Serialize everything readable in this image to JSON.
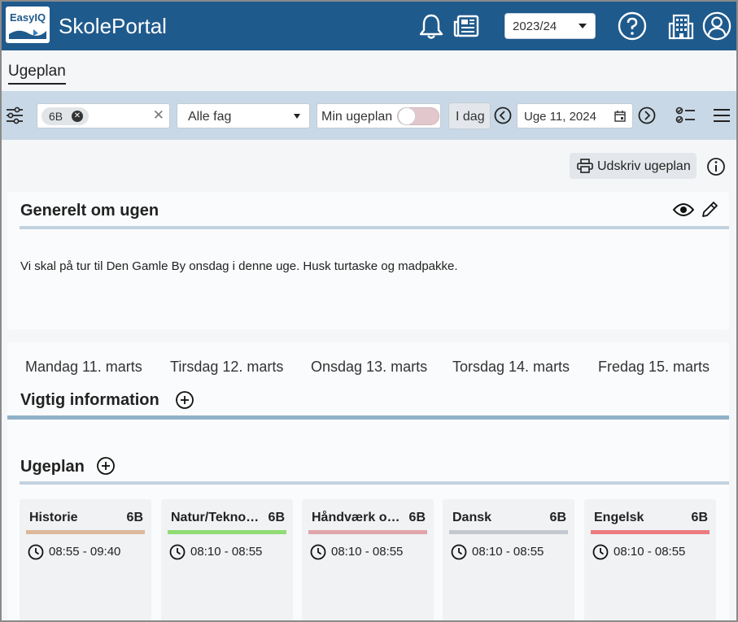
{
  "header": {
    "logo_text": "EasyIQ",
    "app_title": "SkolePortal",
    "year_select": "2023/24",
    "icons": [
      "bell-icon",
      "newspaper-icon",
      "help-icon",
      "building-icon",
      "user-icon"
    ]
  },
  "page": {
    "tab": "Ugeplan"
  },
  "toolbar": {
    "class_chip": "6B",
    "subject_select": "Alle fag",
    "my_plan_label": "Min ugeplan",
    "my_plan_on": false,
    "today_label": "I dag",
    "week_value": "Uge 11, 2024"
  },
  "actions": {
    "print_label": "Udskriv ugeplan"
  },
  "general": {
    "title": "Generelt om ugen",
    "text": "Vi skal på tur til Den Gamle By onsdag i denne uge. Husk turtaske og madpakke."
  },
  "days": [
    "Mandag 11. marts",
    "Tirsdag 12. marts",
    "Onsdag 13. marts",
    "Torsdag 14. marts",
    "Fredag 15. marts"
  ],
  "important": {
    "title": "Vigtig information"
  },
  "weekplan": {
    "title": "Ugeplan"
  },
  "lessons": [
    {
      "subject": "Historie",
      "class": "6B",
      "time": "08:55 - 09:40",
      "color": "#dcb89a"
    },
    {
      "subject": "Natur/Teknologi",
      "class": "6B",
      "time": "08:10 - 08:55",
      "color": "#8fdc72"
    },
    {
      "subject": "Håndværk og design",
      "class": "6B",
      "time": "08:10 - 08:55",
      "color": "#e0a5aa"
    },
    {
      "subject": "Dansk",
      "class": "6B",
      "time": "08:10 - 08:55",
      "color": "#c4c8d0"
    },
    {
      "subject": "Engelsk",
      "class": "6B",
      "time": "08:10 - 08:55",
      "color": "#ec7b7e"
    }
  ],
  "colors": {
    "header_bg": "#1f5a8c",
    "toolbar_bg": "#c9d8e6",
    "accent_rule": "#90b1c9"
  }
}
